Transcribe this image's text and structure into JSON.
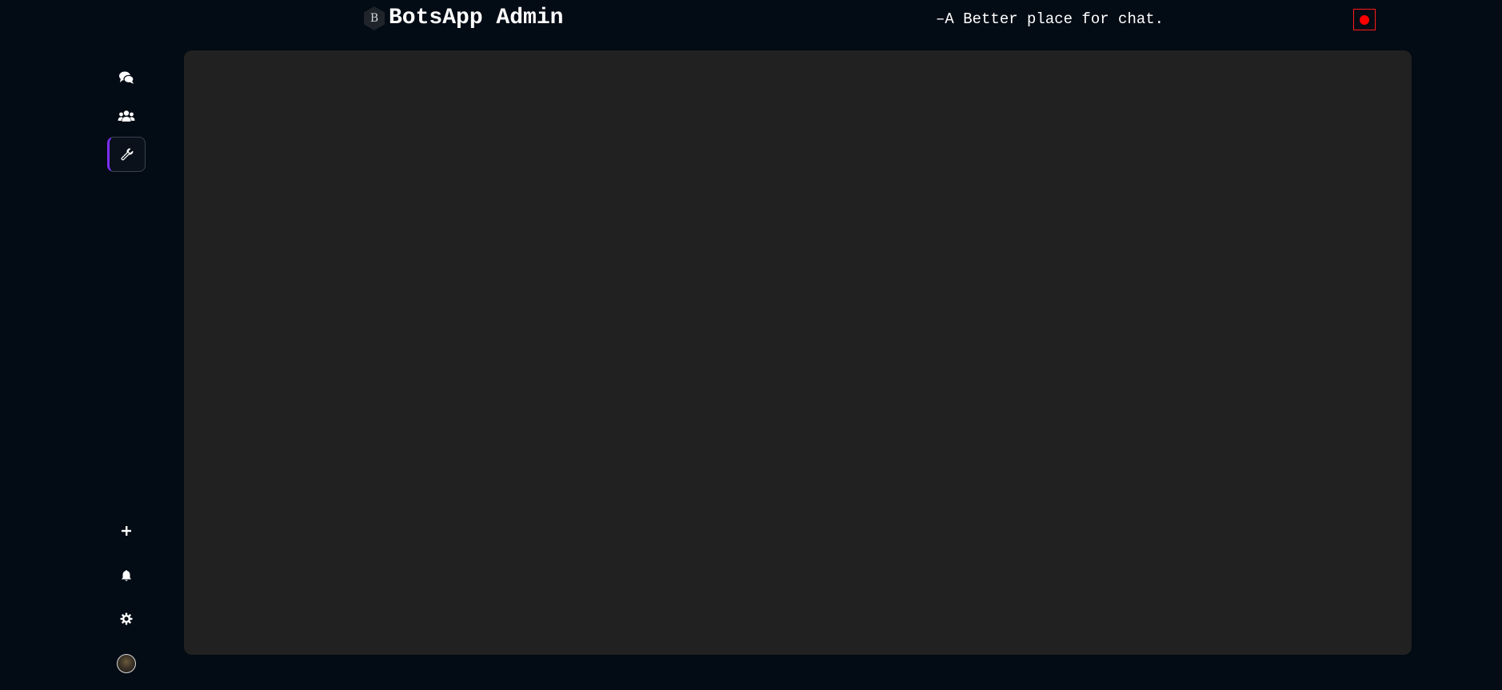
{
  "header": {
    "logo_letter": "B",
    "title": "BotsApp Admin",
    "tagline": "–A Better place for chat.",
    "record_color": "#ff0000"
  },
  "sidebar": {
    "top_items": [
      {
        "name": "chats",
        "icon": "chat-bubbles-icon",
        "active": false
      },
      {
        "name": "groups",
        "icon": "users-icon",
        "active": false
      },
      {
        "name": "admin-tools",
        "icon": "wrench-icon",
        "active": true
      }
    ],
    "bottom_items": [
      {
        "name": "add",
        "icon": "plus-icon"
      },
      {
        "name": "notifications",
        "icon": "bell-icon"
      },
      {
        "name": "settings",
        "icon": "gear-icon"
      },
      {
        "name": "profile",
        "icon": "avatar"
      }
    ],
    "active_accent": "#7b2ff7"
  },
  "main": {
    "background": "#212121"
  }
}
